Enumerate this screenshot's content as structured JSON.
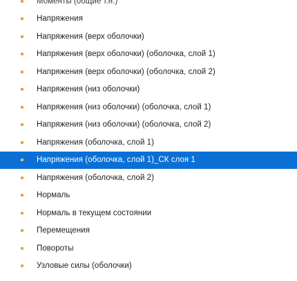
{
  "tree": {
    "items": [
      {
        "label": "Моменты (общие т.н.)",
        "selected": false
      },
      {
        "label": "Напряжения",
        "selected": false
      },
      {
        "label": "Напряжения (верх оболочки)",
        "selected": false
      },
      {
        "label": "Напряжения (верх оболочки) (оболочка, слой 1)",
        "selected": false
      },
      {
        "label": "Напряжения (верх оболочки) (оболочка, слой 2)",
        "selected": false
      },
      {
        "label": "Напряжения (низ оболочки)",
        "selected": false
      },
      {
        "label": "Напряжения (низ оболочки) (оболочка, слой 1)",
        "selected": false
      },
      {
        "label": "Напряжения (низ оболочки) (оболочка, слой 2)",
        "selected": false
      },
      {
        "label": "Напряжения (оболочка, слой 1)",
        "selected": false
      },
      {
        "label": "Напряжения (оболочка, слой 1)_СК слоя 1",
        "selected": true
      },
      {
        "label": "Напряжения (оболочка, слой 2)",
        "selected": false
      },
      {
        "label": "Нормаль",
        "selected": false
      },
      {
        "label": "Нормаль в текущем состоянии",
        "selected": false
      },
      {
        "label": "Перемещения",
        "selected": false
      },
      {
        "label": "Повороты",
        "selected": false
      },
      {
        "label": "Узловые силы (оболочки)",
        "selected": false
      }
    ]
  },
  "colors": {
    "selection": "#0a70d6",
    "bullet": "#e8a33c"
  }
}
